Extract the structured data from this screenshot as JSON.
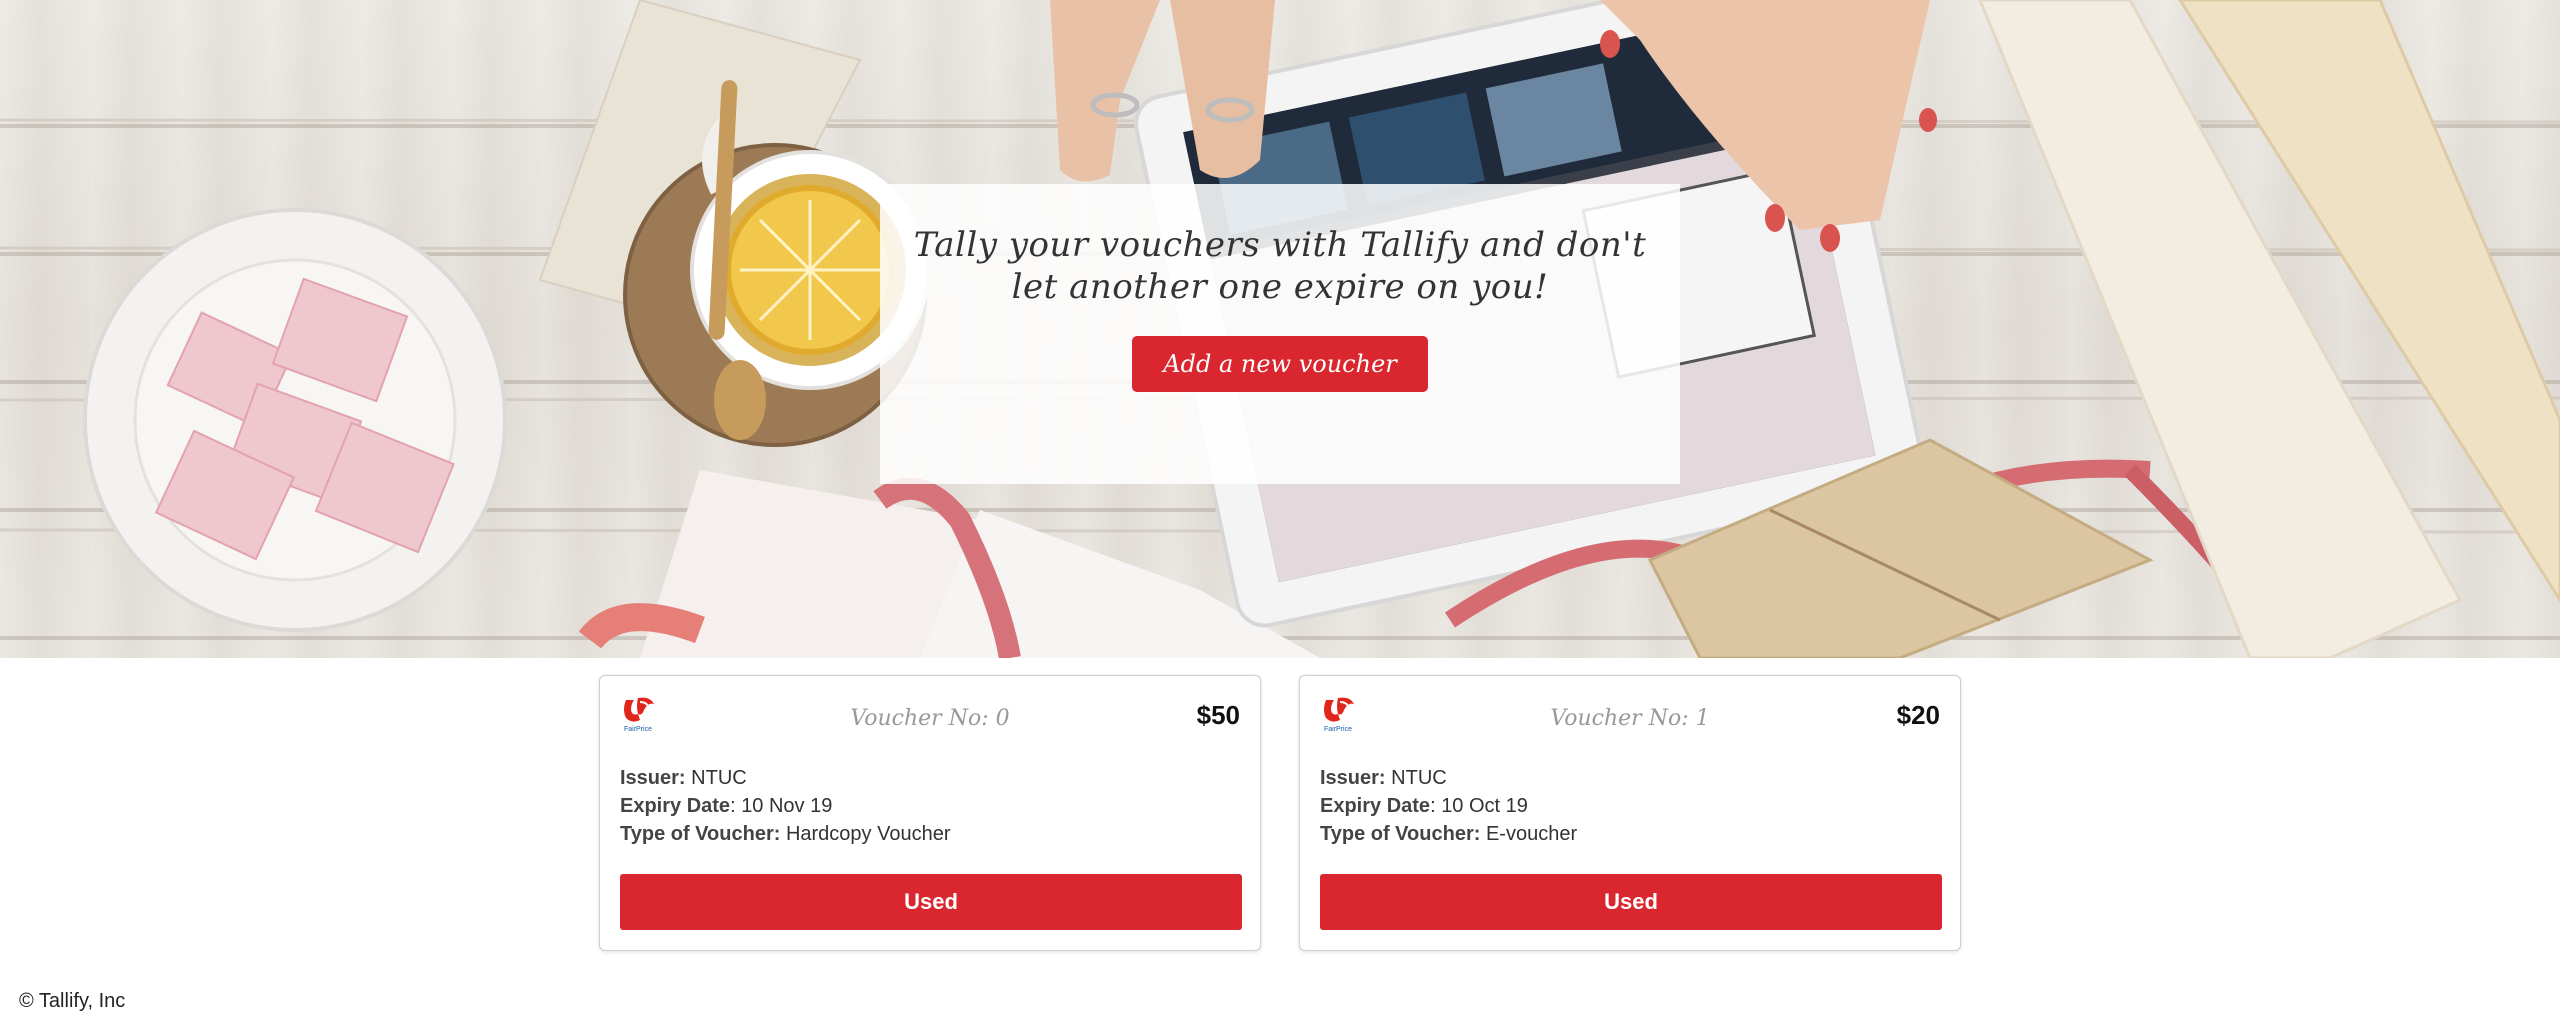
{
  "hero": {
    "tagline": "Tally your vouchers with Tallify and don't let another one expire on you!",
    "add_button_label": "Add a new voucher"
  },
  "vouchers": [
    {
      "title": "Voucher No: 0",
      "amount": "$50",
      "logo_text": "FairPrice",
      "issuer_label": "Issuer:",
      "issuer": "NTUC",
      "expiry_label": "Expiry Date",
      "expiry": "10 Nov 19",
      "type_label": "Type of Voucher:",
      "type": "Hardcopy Voucher",
      "button_label": "Used"
    },
    {
      "title": "Voucher No: 1",
      "amount": "$20",
      "logo_text": "FairPrice",
      "issuer_label": "Issuer:",
      "issuer": "NTUC",
      "expiry_label": "Expiry Date",
      "expiry": "10 Oct 19",
      "type_label": "Type of Voucher:",
      "type": "E-voucher",
      "button_label": "Used"
    }
  ],
  "footer": {
    "copyright": "© Tallify, Inc"
  },
  "colors": {
    "accent": "#d9262f",
    "logo_red": "#e1261c",
    "logo_blue": "#1a5aa8"
  }
}
